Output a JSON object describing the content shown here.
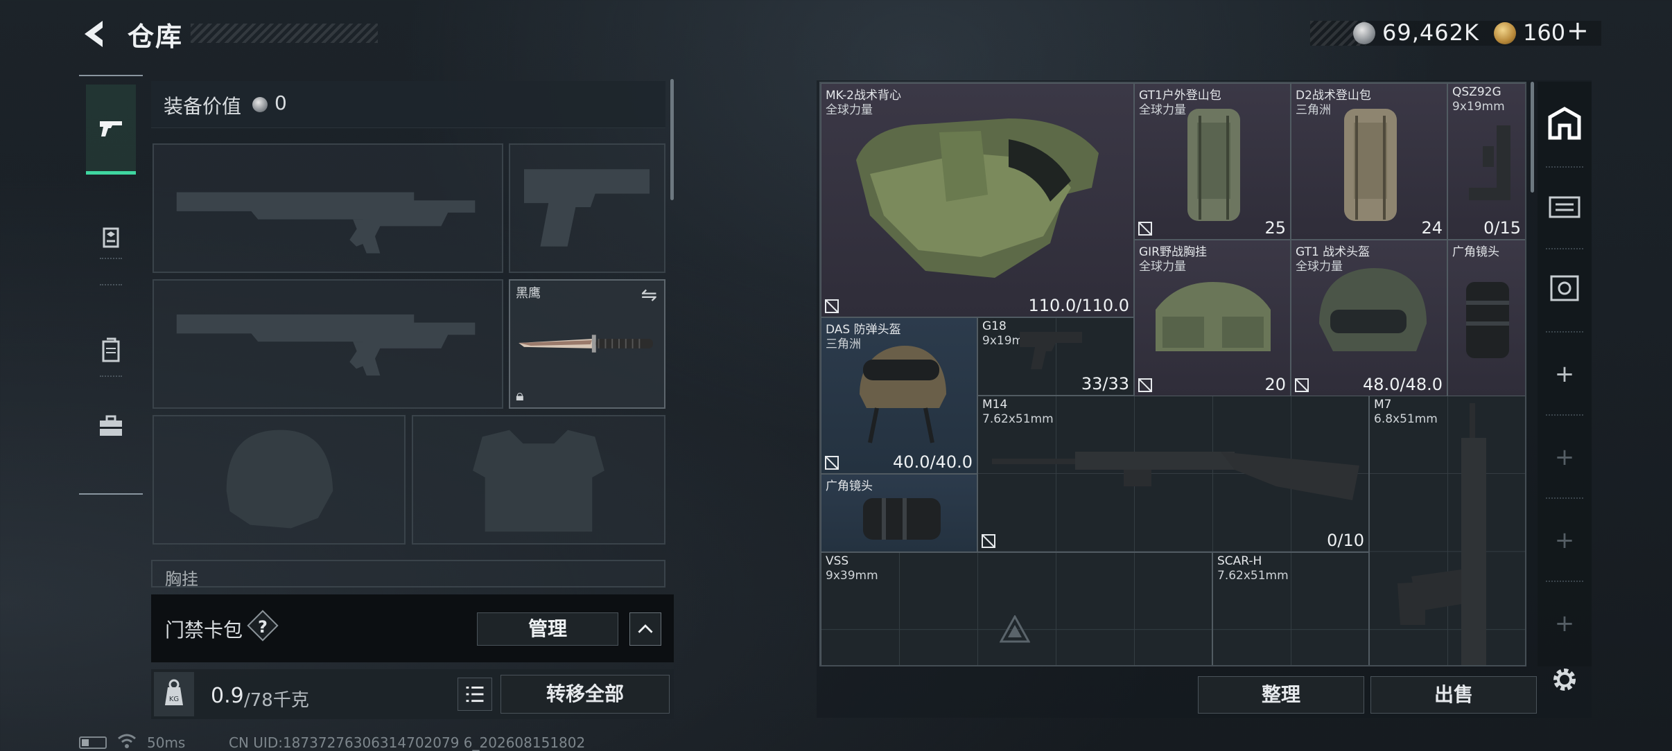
{
  "header": {
    "title": "仓库",
    "silver_amount": "69,462K",
    "gold_amount": "160",
    "gold_add": "+"
  },
  "equipment": {
    "value_label": "装备价值",
    "value": "0",
    "knife_slot_label": "黑鹰",
    "chest_rig_label": "胸挂",
    "access_card_label": "门禁卡包",
    "access_help": "?",
    "manage_label": "管理",
    "capacity_current": "0.9",
    "capacity_max": "/78千克",
    "transfer_label": "转移全部"
  },
  "status_bar": {
    "ping": "50ms",
    "uid": "CN UID:18737276306314702079 6_202608151802"
  },
  "stash": {
    "items": [
      {
        "name": "MK-2战术背心",
        "sub": "全球力量",
        "value": "110.0/110.0"
      },
      {
        "name": "GT1户外登山包",
        "sub": "全球力量",
        "value": "25"
      },
      {
        "name": "D2战术登山包",
        "sub": "三角洲",
        "value": "24"
      },
      {
        "name": "QSZ92G",
        "sub": "9x19mm",
        "value": "0/15"
      },
      {
        "name": "GIR野战胸挂",
        "sub": "全球力量",
        "value": "20"
      },
      {
        "name": "GT1 战术头盔",
        "sub": "全球力量",
        "value": "48.0/48.0"
      },
      {
        "name": "广角镜头",
        "sub": "",
        "value": ""
      },
      {
        "name": "DAS 防弹头盔",
        "sub": "三角洲",
        "value": "40.0/40.0"
      },
      {
        "name": "G18",
        "sub": "9x19mm",
        "value": "33/33"
      },
      {
        "name": "M14",
        "sub": "7.62x51mm",
        "value": "0/10"
      },
      {
        "name": "M7",
        "sub": "6.8x51mm",
        "value": ""
      },
      {
        "name": "广角镜头",
        "sub": "",
        "value": ""
      },
      {
        "name": "VSS",
        "sub": "9x39mm",
        "value": ""
      },
      {
        "name": "SCAR-H",
        "sub": "7.62x51mm",
        "value": ""
      }
    ],
    "organize_label": "整理",
    "sell_label": "出售"
  },
  "colors": {
    "accent_green": "#3fd6a0",
    "rarity_purple": "#3b3846",
    "rarity_blue": "#2c3b4c"
  },
  "icons": {
    "back": "chevron-left-icon",
    "tabs_left": [
      "pistol-icon",
      "helmet-icon",
      "backpack-icon",
      "briefcase-icon"
    ],
    "tabs_right": [
      "stash-icon",
      "container-icon",
      "money-crate-icon",
      "add-icon"
    ]
  }
}
